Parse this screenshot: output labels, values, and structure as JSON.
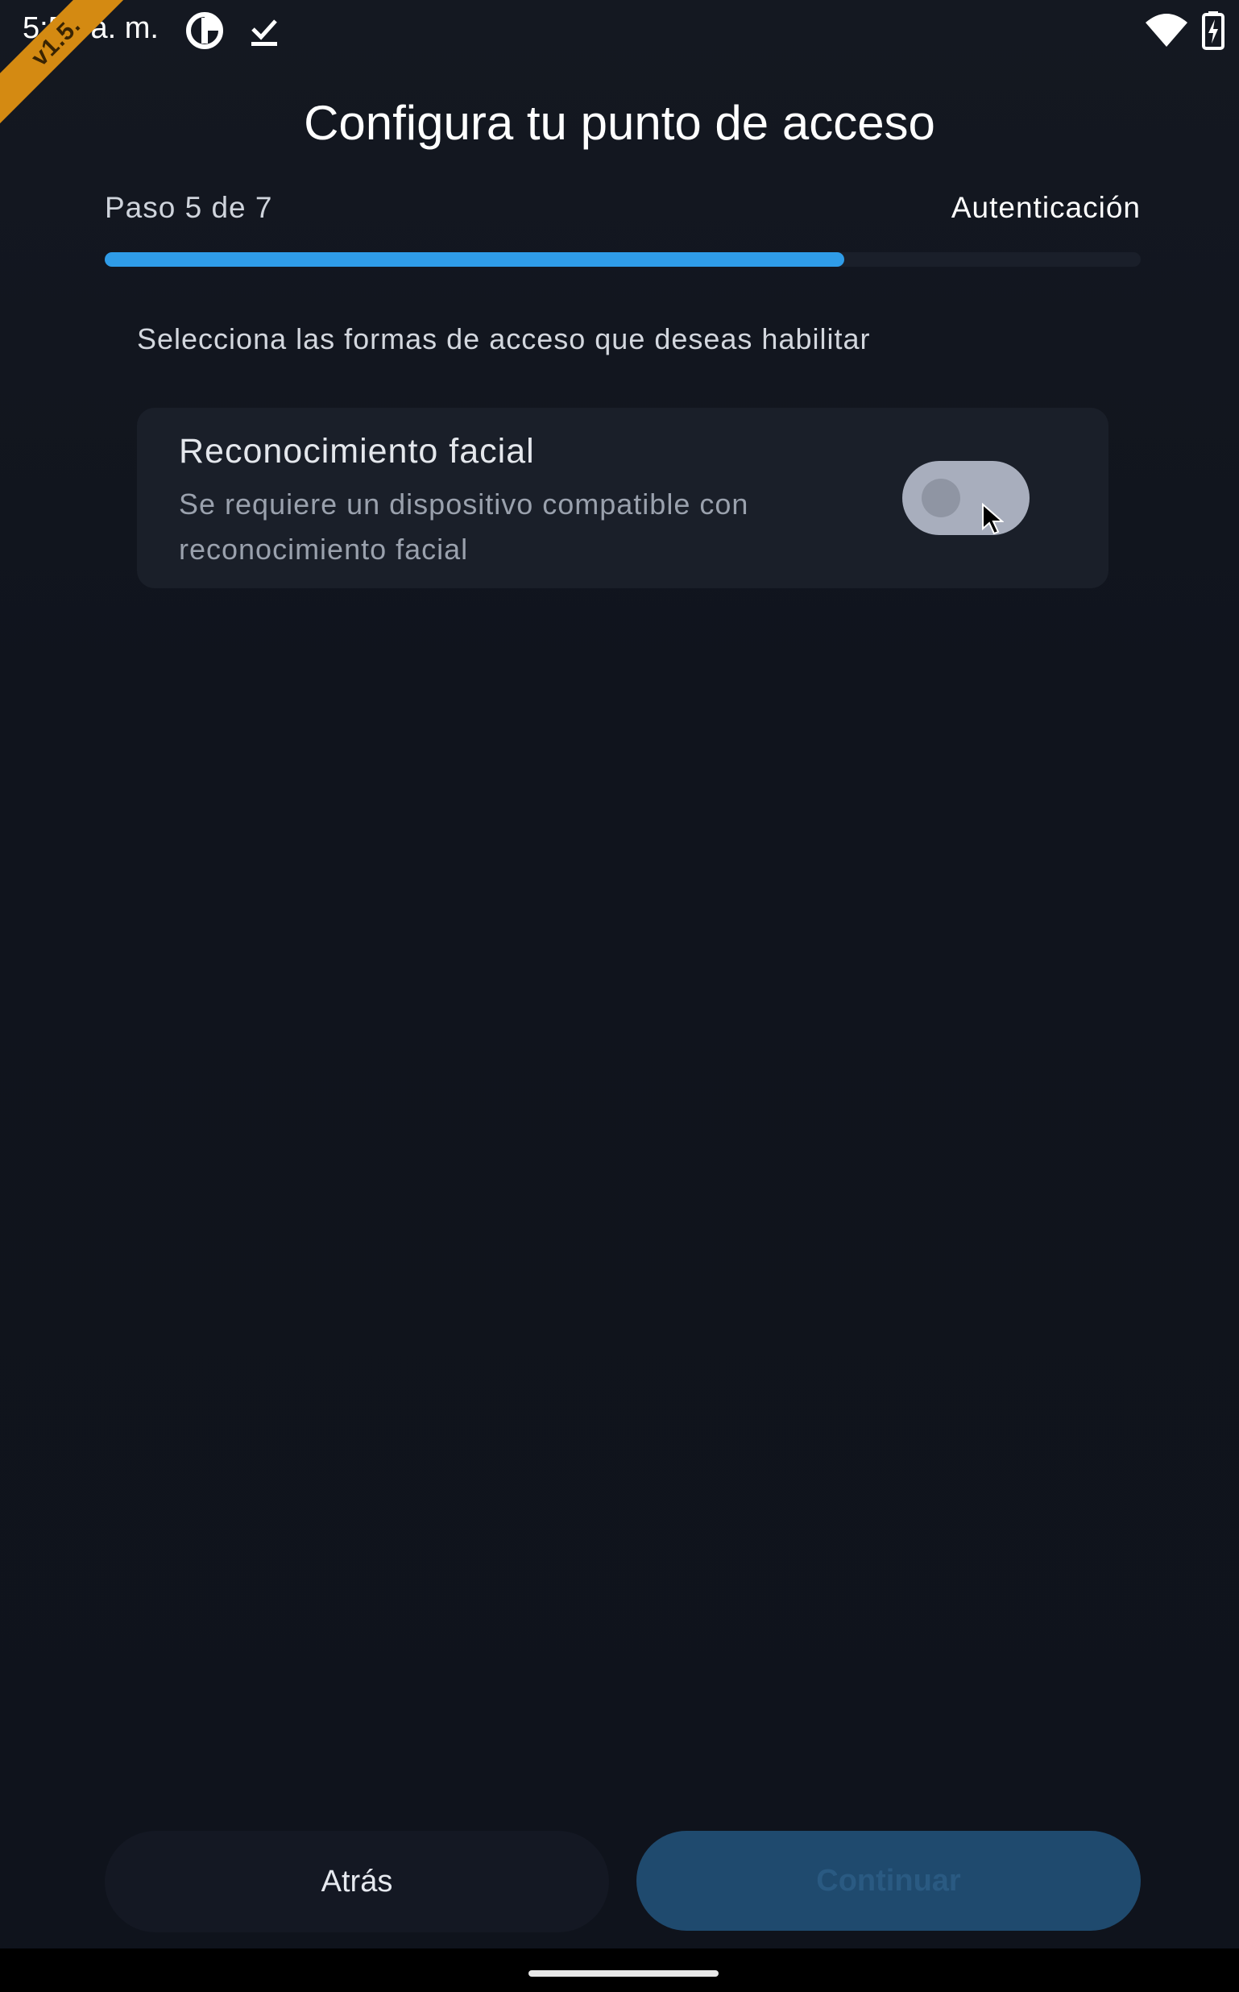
{
  "status_bar": {
    "time": "5:54 a. m.",
    "icons_left": [
      "data-saver-icon",
      "download-done-icon"
    ],
    "icons_right": [
      "wifi-icon",
      "battery-charging-icon"
    ]
  },
  "ribbon": {
    "label": "v1.5."
  },
  "header": {
    "title": "Configura tu punto de acceso",
    "step_label": "Paso 5 de 7",
    "step_name": "Autenticación",
    "progress": 0.714
  },
  "instruction": "Selecciona las formas de acceso que deseas habilitar",
  "options": [
    {
      "title": "Reconocimiento facial",
      "description": "Se requiere un dispositivo compatible con reconocimiento facial",
      "enabled": false
    }
  ],
  "buttons": {
    "back_label": "Atrás",
    "continue_label": "Continuar"
  },
  "colors": {
    "accent": "#2f9ce8",
    "background": "#10131c",
    "card": "#1a1f29",
    "ribbon": "#d48a12"
  }
}
